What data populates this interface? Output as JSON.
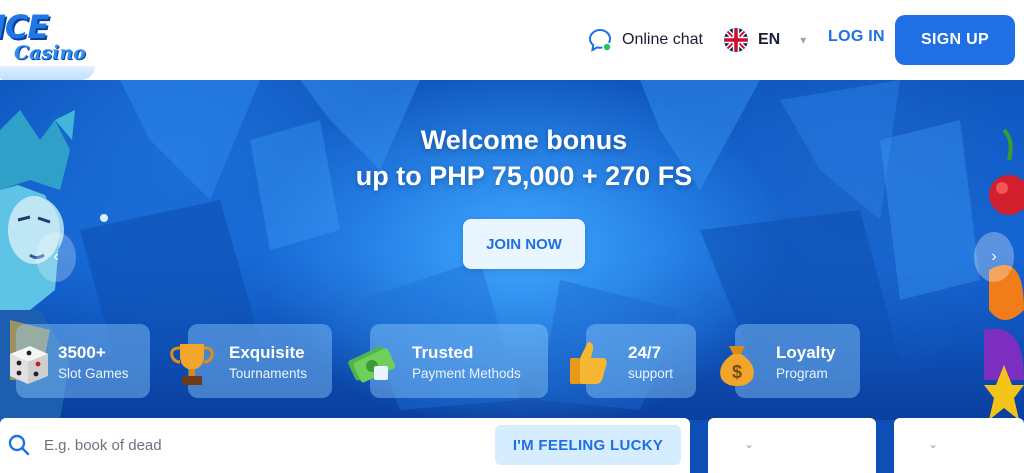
{
  "header": {
    "logo_main": "ICE",
    "logo_sub": "Casino",
    "chat_label": "Online chat",
    "lang_code": "EN",
    "login_label": "LOG IN",
    "signup_label": "SIGN UP"
  },
  "hero": {
    "headline_line1": "Welcome bonus",
    "headline_line2": "up to PHP 75,000 + 270 FS",
    "join_label": "JOIN NOW"
  },
  "features": [
    {
      "title": "3500+",
      "subtitle": "Slot Games",
      "icon": "dice-icon"
    },
    {
      "title": "Exquisite",
      "subtitle": "Tournaments",
      "icon": "trophy-icon"
    },
    {
      "title": "Trusted",
      "subtitle": "Payment Methods",
      "icon": "money-icon"
    },
    {
      "title": "24/7",
      "subtitle": "support",
      "icon": "thumbs-up-icon"
    },
    {
      "title": "Loyalty",
      "subtitle": "Program",
      "icon": "money-bag-icon"
    }
  ],
  "search": {
    "placeholder": "E.g. book of dead",
    "lucky_label": "I'M FEELING LUCKY"
  },
  "colors": {
    "accent": "#1f6fe5",
    "hero_blue": "#1466d6",
    "button_light": "#eaf6ff"
  }
}
